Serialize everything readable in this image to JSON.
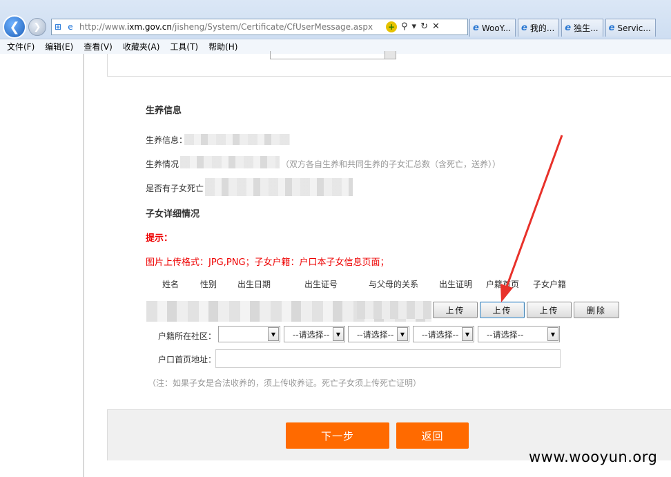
{
  "browser": {
    "url_prefix": "http://www.",
    "url_domain": "ixm.gov.cn",
    "url_path": "/jisheng/System/Certificate/CfUserMessage.aspx",
    "tabs": [
      {
        "label": "WooY..."
      },
      {
        "label": "我的..."
      },
      {
        "label": "独生..."
      },
      {
        "label": "Servic..."
      }
    ],
    "menu": [
      "文件(F)",
      "编辑(E)",
      "查看(V)",
      "收藏夹(A)",
      "工具(T)",
      "帮助(H)"
    ]
  },
  "section": {
    "title": "生养信息",
    "info_label": "生养信息：",
    "status_label": "生养情况",
    "status_hint": "（双方各自生养和共同生养的子女汇总数（含死亡，送养））",
    "death_label": "是否有子女死亡",
    "children_title": "子女详细情况",
    "tip_label": "提示：",
    "tip_text": "图片上传格式：JPG,PNG；子女户籍：户口本子女信息页面；"
  },
  "table": {
    "headers": [
      "姓名",
      "性别",
      "出生日期",
      "出生证号",
      "与父母的关系",
      "出生证明",
      "户籍首页",
      "子女户籍"
    ],
    "buttons": {
      "upload1": "上传",
      "upload2": "上传",
      "upload3": "上传",
      "delete": "删除"
    }
  },
  "address": {
    "community_label": "户籍所在社区：",
    "select_placeholder": "--请选择--",
    "homepage_label": "户口首页地址：",
    "note": "（注：如果子女是合法收养的，须上传收养证。死亡子女须上传死亡证明）"
  },
  "actions": {
    "next": "下一步",
    "back": "返回"
  },
  "watermark": "www.wooyun.org",
  "colors": {
    "accent": "#ff6a00",
    "tip_red": "#ee0000",
    "annotation_arrow": "#e8312a"
  }
}
